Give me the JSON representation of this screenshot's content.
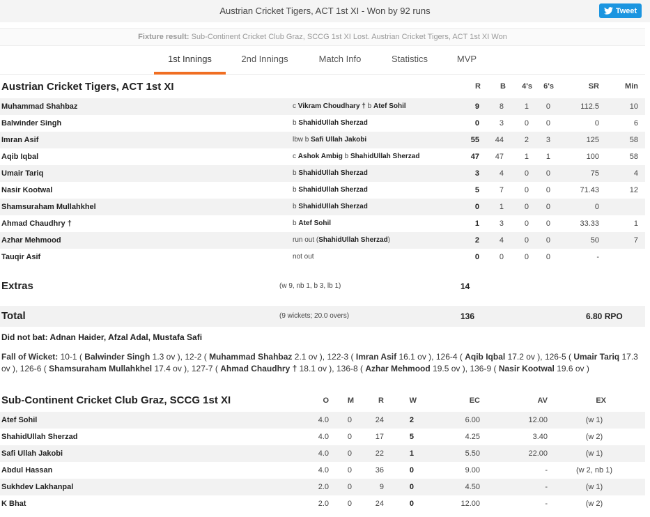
{
  "header": {
    "title": "Austrian Cricket Tigers, ACT 1st XI - Won by 92 runs",
    "tweet_label": "Tweet"
  },
  "fixture": {
    "label": "Fixture result:",
    "text": "Sub-Continent Cricket Club Graz, SCCG 1st XI Lost. Austrian Cricket Tigers, ACT 1st XI Won"
  },
  "tabs": [
    "1st Innings",
    "2nd Innings",
    "Match Info",
    "Statistics",
    "MVP"
  ],
  "active_tab": "1st Innings",
  "batting": {
    "team": "Austrian Cricket Tigers, ACT 1st XI",
    "headers": {
      "r": "R",
      "b": "B",
      "fours": "4's",
      "sixes": "6's",
      "sr": "SR",
      "min": "Min"
    },
    "rows": [
      {
        "name": "Muhammad Shahbaz",
        "how": [
          "c ",
          "Vikram Choudhary †",
          " b ",
          "Atef Sohil",
          ""
        ],
        "r": "9",
        "b": "8",
        "fours": "1",
        "sixes": "0",
        "sr": "112.5",
        "min": "10"
      },
      {
        "name": "Balwinder Singh",
        "how": [
          "b ",
          "ShahidUllah Sherzad",
          "",
          "",
          ""
        ],
        "r": "0",
        "b": "3",
        "fours": "0",
        "sixes": "0",
        "sr": "0",
        "min": "6"
      },
      {
        "name": "Imran Asif",
        "how": [
          "lbw b ",
          "Safi Ullah Jakobi",
          "",
          "",
          ""
        ],
        "r": "55",
        "b": "44",
        "fours": "2",
        "sixes": "3",
        "sr": "125",
        "min": "58"
      },
      {
        "name": "Aqib Iqbal",
        "how": [
          "c ",
          "Ashok Ambig",
          " b ",
          "ShahidUllah Sherzad",
          ""
        ],
        "r": "47",
        "b": "47",
        "fours": "1",
        "sixes": "1",
        "sr": "100",
        "min": "58"
      },
      {
        "name": "Umair Tariq",
        "how": [
          "b ",
          "ShahidUllah Sherzad",
          "",
          "",
          ""
        ],
        "r": "3",
        "b": "4",
        "fours": "0",
        "sixes": "0",
        "sr": "75",
        "min": "4"
      },
      {
        "name": "Nasir Kootwal",
        "how": [
          "b ",
          "ShahidUllah Sherzad",
          "",
          "",
          ""
        ],
        "r": "5",
        "b": "7",
        "fours": "0",
        "sixes": "0",
        "sr": "71.43",
        "min": "12"
      },
      {
        "name": "Shamsuraham Mullahkhel",
        "how": [
          "b ",
          "ShahidUllah Sherzad",
          "",
          "",
          ""
        ],
        "r": "0",
        "b": "1",
        "fours": "0",
        "sixes": "0",
        "sr": "0",
        "min": ""
      },
      {
        "name": "Ahmad Chaudhry †",
        "how": [
          "b ",
          "Atef Sohil",
          "",
          "",
          ""
        ],
        "r": "1",
        "b": "3",
        "fours": "0",
        "sixes": "0",
        "sr": "33.33",
        "min": "1"
      },
      {
        "name": "Azhar Mehmood",
        "how": [
          "run out (",
          "ShahidUllah Sherzad",
          ")",
          "",
          ""
        ],
        "r": "2",
        "b": "4",
        "fours": "0",
        "sixes": "0",
        "sr": "50",
        "min": "7"
      },
      {
        "name": "Tauqir Asif",
        "how": [
          "not out",
          "",
          "",
          "",
          ""
        ],
        "r": "0",
        "b": "0",
        "fours": "0",
        "sixes": "0",
        "sr": "-",
        "min": ""
      }
    ],
    "extras": {
      "label": "Extras",
      "detail": "(w 9, nb 1, b 3, lb 1)",
      "value": "14"
    },
    "total": {
      "label": "Total",
      "detail": "(9 wickets; 20.0 overs)",
      "value": "136",
      "rpo": "6.80 RPO"
    },
    "did_not_bat": "Did not bat: Adnan Haider, Afzal Adal, Mustafa Safi",
    "fall_of_wickets": {
      "label": "Fall of Wicket:",
      "items": [
        {
          "score": "10-1",
          "player": "Balwinder Singh",
          "over": "1.3 ov"
        },
        {
          "score": "12-2",
          "player": "Muhammad Shahbaz",
          "over": "2.1 ov"
        },
        {
          "score": "122-3",
          "player": "Imran Asif",
          "over": "16.1 ov"
        },
        {
          "score": "126-4",
          "player": "Aqib Iqbal",
          "over": "17.2 ov"
        },
        {
          "score": "126-5",
          "player": "Umair Tariq",
          "over": "17.3 ov"
        },
        {
          "score": "126-6",
          "player": "Shamsuraham Mullahkhel",
          "over": "17.4 ov"
        },
        {
          "score": "127-7",
          "player": "Ahmad Chaudhry †",
          "over": "18.1 ov"
        },
        {
          "score": "136-8",
          "player": "Azhar Mehmood",
          "over": "19.5 ov"
        },
        {
          "score": "136-9",
          "player": "Nasir Kootwal",
          "over": "19.6 ov"
        }
      ]
    }
  },
  "bowling": {
    "team": "Sub-Continent Cricket Club Graz, SCCG 1st XI",
    "headers": {
      "o": "O",
      "m": "M",
      "r": "R",
      "w": "W",
      "ec": "EC",
      "av": "AV",
      "ex": "EX"
    },
    "rows": [
      {
        "name": "Atef Sohil",
        "o": "4.0",
        "m": "0",
        "r": "24",
        "w": "2",
        "ec": "6.00",
        "av": "12.00",
        "ex": "(w 1)"
      },
      {
        "name": "ShahidUllah Sherzad",
        "o": "4.0",
        "m": "0",
        "r": "17",
        "w": "5",
        "ec": "4.25",
        "av": "3.40",
        "ex": "(w 2)"
      },
      {
        "name": "Safi Ullah Jakobi",
        "o": "4.0",
        "m": "0",
        "r": "22",
        "w": "1",
        "ec": "5.50",
        "av": "22.00",
        "ex": "(w 1)"
      },
      {
        "name": "Abdul Hassan",
        "o": "4.0",
        "m": "0",
        "r": "36",
        "w": "0",
        "ec": "9.00",
        "av": "-",
        "ex": "(w 2, nb 1)"
      },
      {
        "name": "Sukhdev Lakhanpal",
        "o": "2.0",
        "m": "0",
        "r": "9",
        "w": "0",
        "ec": "4.50",
        "av": "-",
        "ex": "(w 1)"
      },
      {
        "name": "K Bhat",
        "o": "2.0",
        "m": "0",
        "r": "24",
        "w": "0",
        "ec": "12.00",
        "av": "-",
        "ex": "(w 2)"
      }
    ]
  },
  "colors": {
    "accent": "#f06e22",
    "tweet": "#1b95e0",
    "row_alt": "#f2f2f2"
  }
}
